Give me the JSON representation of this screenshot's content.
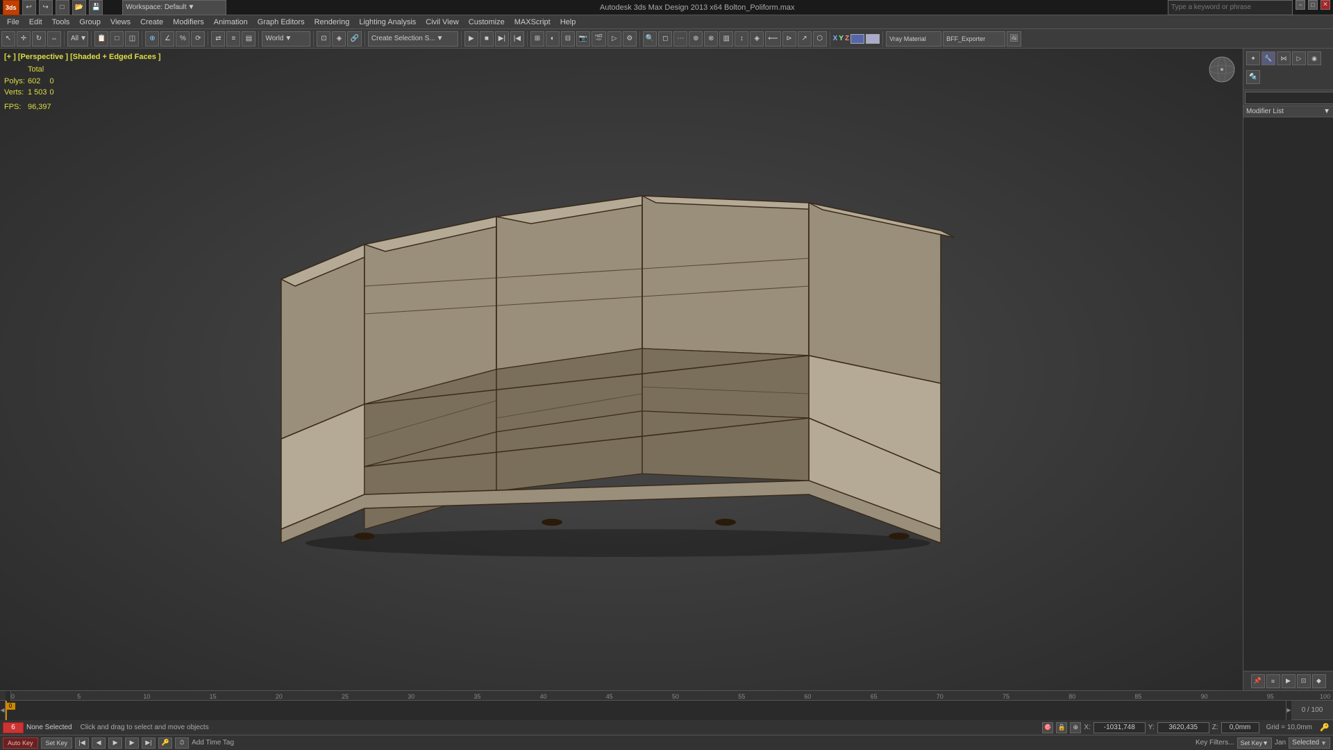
{
  "app": {
    "title": "Autodesk 3ds Max Design 2013 x64    Bolton_Poliform.max",
    "workspace": "Workspace: Default"
  },
  "title_bar": {
    "app_icon": "3ds",
    "minimize": "−",
    "restore": "□",
    "close": "✕"
  },
  "menu": {
    "items": [
      "File",
      "Edit",
      "Tools",
      "Group",
      "Views",
      "Create",
      "Modifiers",
      "Animation",
      "Graph Editors",
      "Rendering",
      "Lighting Analysis",
      "Civil View",
      "Customize",
      "MAXScript",
      "Help"
    ]
  },
  "toolbar": {
    "world_label": "World",
    "create_selection_label": "Create Selection S...",
    "search_placeholder": "Type a keyword or phrase",
    "axes": [
      "X",
      "Y",
      "Z"
    ],
    "exporter_label": "BFF_Exporter"
  },
  "viewport": {
    "label": "[+ ] [Perspective ] [Shaded + Edged Faces ]",
    "stats": {
      "polys_label": "Polys:",
      "polys_total": "602",
      "polys_selected": "0",
      "verts_label": "Verts:",
      "verts_total": "1 503",
      "verts_selected": "0",
      "fps_label": "FPS:",
      "fps_value": "96,397",
      "total_header": "Total"
    }
  },
  "right_panel": {
    "modifier_list_label": "Modifier List",
    "search_placeholder": ""
  },
  "timeline": {
    "counter": "0 / 100",
    "frame_ticks": [
      "0",
      "5",
      "10",
      "15",
      "20",
      "25",
      "30",
      "35",
      "40",
      "45",
      "50",
      "55",
      "60",
      "65",
      "70",
      "75",
      "80",
      "85",
      "90",
      "95",
      "100"
    ]
  },
  "status_bar": {
    "frame_value": "6",
    "none_selected": "None Selected",
    "help_text": "Click and drag to select and move objects",
    "x_label": "X:",
    "x_value": "-1031,748",
    "y_label": "Y:",
    "y_value": "3620,435",
    "z_label": "Z:",
    "z_value": "0,0mm",
    "grid_label": "Grid = 10,0mm",
    "auto_key": "Auto Key",
    "set_key": "Set Key",
    "key_filters": "Key Filters...",
    "selected_label": "Selected",
    "add_time_tag": "Add Time Tag",
    "jan_label": "Jan"
  },
  "bottom_playback": {
    "selected_label": "Selected"
  }
}
